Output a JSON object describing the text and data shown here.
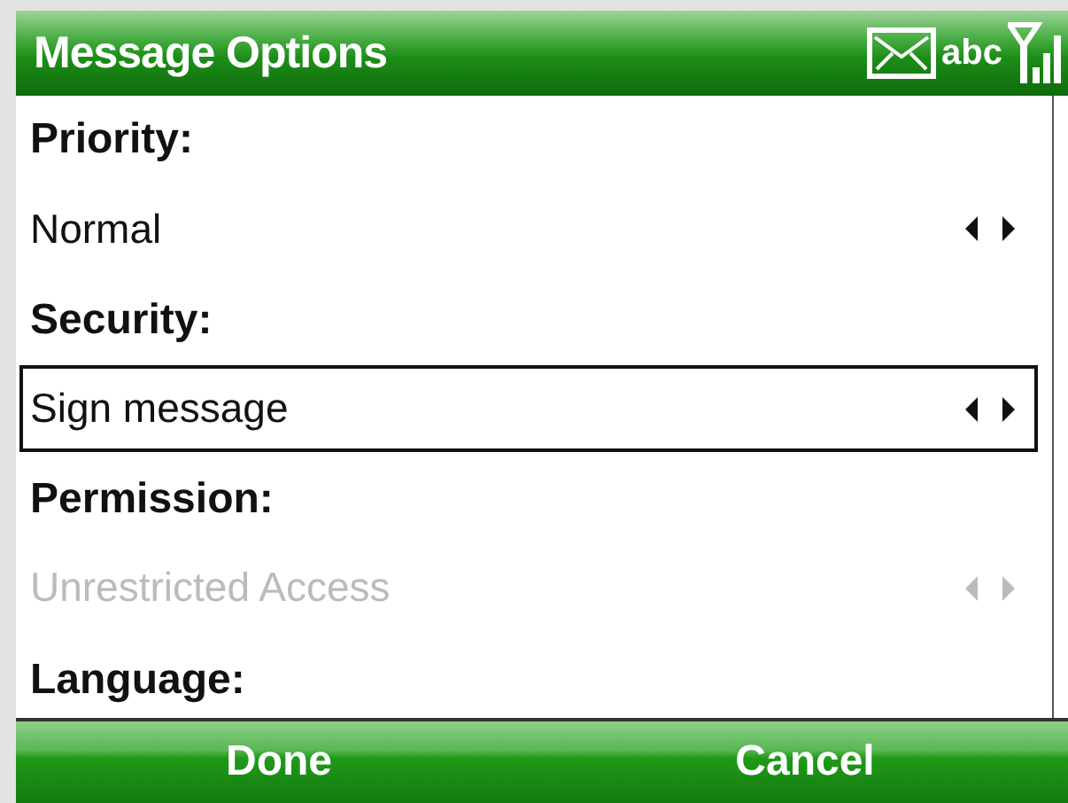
{
  "title_bar": {
    "title": "Message Options",
    "input_mode": "abc"
  },
  "fields": [
    {
      "label": "Priority:",
      "value": "Normal",
      "selected": false,
      "disabled": false
    },
    {
      "label": "Security:",
      "value": "Sign message",
      "selected": true,
      "disabled": false
    },
    {
      "label": "Permission:",
      "value": "Unrestricted Access",
      "selected": false,
      "disabled": true
    },
    {
      "label": "Language:"
    }
  ],
  "softkeys": [
    "Done",
    "Cancel"
  ]
}
